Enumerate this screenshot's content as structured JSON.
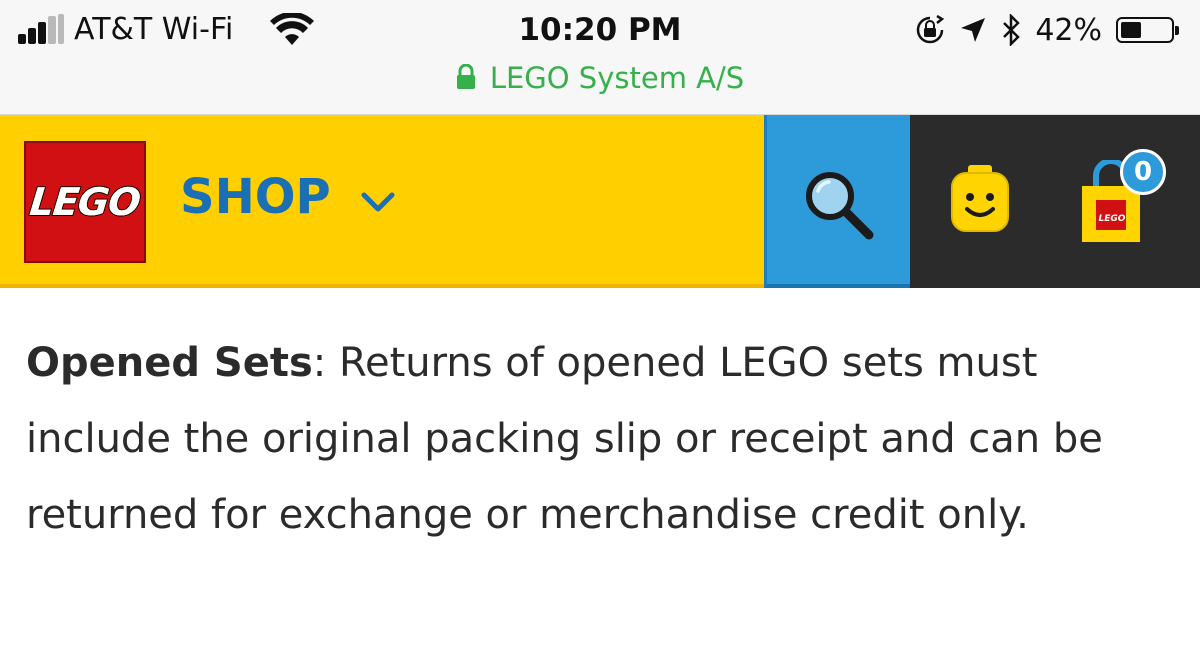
{
  "status_bar": {
    "carrier": "AT&T Wi-Fi",
    "time": "10:20 PM",
    "site_name": "LEGO System A/S",
    "battery_percent": "42%",
    "battery_level": 0.42,
    "signal_bars_active": 3,
    "signal_bars_total": 5
  },
  "header": {
    "logo_text": "LEGO",
    "shop_label": "SHOP",
    "bag_count": "0",
    "bag_logo_text": "LEGO"
  },
  "content": {
    "heading": "Opened Sets",
    "separator": ":",
    "body": " Returns of opened LEGO sets must include the original packing slip or receipt and can be returned for exchange or merchandise credit only."
  },
  "colors": {
    "header_yellow": "#ffcf00",
    "search_blue": "#2d9ad9",
    "dark_bg": "#2b2b2b",
    "lego_red": "#d01012",
    "secure_green": "#35b04a",
    "shop_blue": "#1a6fb5"
  }
}
